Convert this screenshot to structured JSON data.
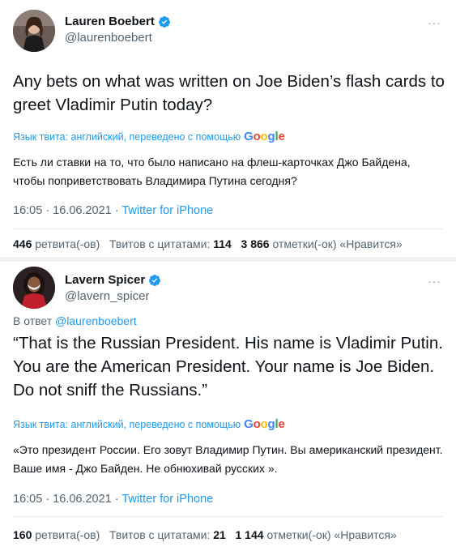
{
  "tweet1": {
    "name": "Lauren Boebert",
    "handle": "@laurenboebert",
    "more": "···",
    "text_en": "Any bets on what was written on Joe Biden’s flash cards to greet Vladimir Putin today?",
    "translate_label": "Язык твита: английский, переведено с помощью",
    "translate_brand": "Google",
    "text_ru": "Есть ли ставки на то, что было написано на флеш-карточках Джо Байдена, чтобы поприветствовать Владимира Путина сегодня?",
    "time": "16:05 · 16.06.2021 · ",
    "source": "Twitter for iPhone",
    "retweets_count": "446",
    "retweets_label": "ретвита(-ов)",
    "quotes_label": "Твитов с цитатами:",
    "quotes_count": "114",
    "likes_count": "3 866",
    "likes_label": "отметки(-ок) «Нравится»"
  },
  "tweet2": {
    "name": "Lavern Spicer",
    "handle": "@lavern_spicer",
    "more": "···",
    "reply_prefix": "В ответ",
    "reply_mention": "@laurenboebert",
    "text_en": "“That is the Russian President. His name is Vladimir Putin. You are the American President. Your name is Joe Biden. Do not sniff the Russians.”",
    "translate_label": "Язык твита: английский, переведено с помощью",
    "translate_brand": "Google",
    "text_ru": "«Это президент России. Его зовут Владимир Путин. Вы американский президент. Ваше имя - Джо Байден. Не обнюхивай русских ».",
    "time": "16:05 · 16.06.2021 · ",
    "source": "Twitter for iPhone",
    "retweets_count": "160",
    "retweets_label": "ретвита(-ов)",
    "quotes_label": "Твитов с цитатами:",
    "quotes_count": "21",
    "likes_count": "1 144",
    "likes_label": "отметки(-ок) «Нравится»"
  },
  "colors": {
    "link": "#1d9bf0",
    "verified": "#1d9bf0",
    "secondary": "#536471"
  }
}
